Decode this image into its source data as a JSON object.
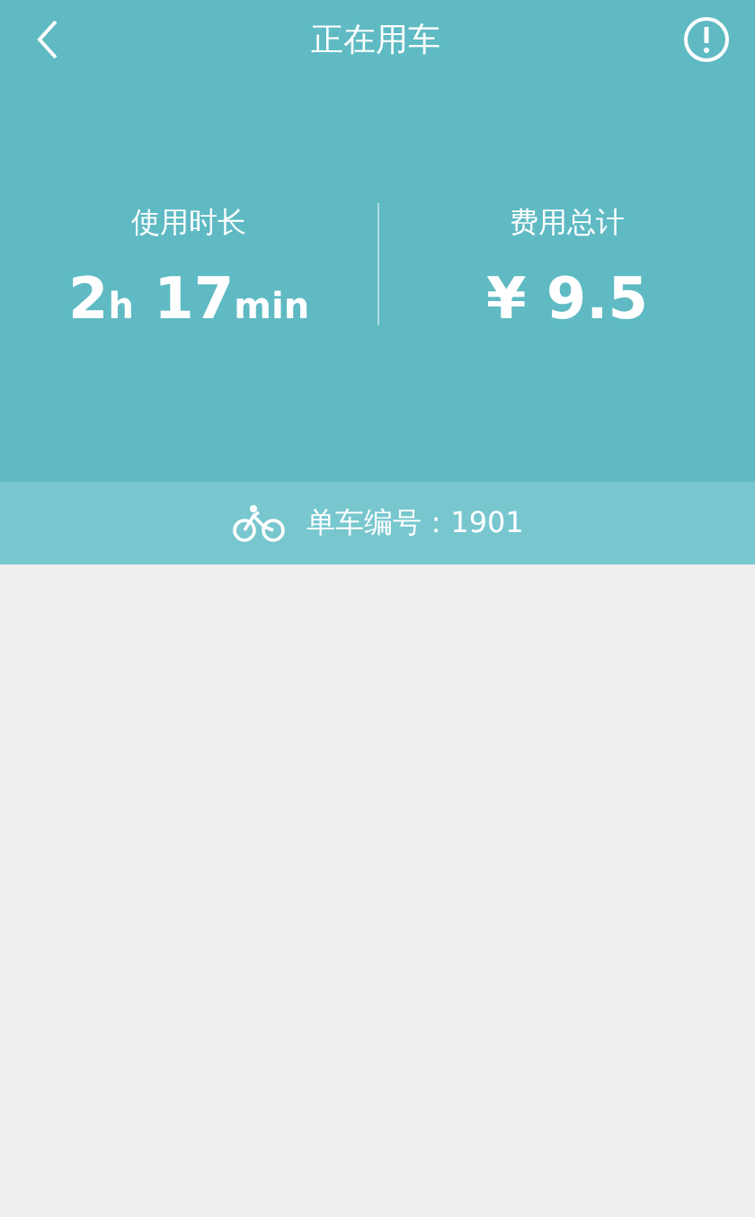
{
  "header": {
    "title": "正在用车"
  },
  "stats": [
    {
      "label": "使用时长",
      "parts": [
        {
          "kind": "number",
          "text": "2"
        },
        {
          "kind": "unit",
          "text": "h"
        },
        {
          "kind": "number",
          "text": " 17"
        },
        {
          "kind": "unit",
          "text": "min"
        }
      ]
    },
    {
      "label": "费用总计",
      "parts": [
        {
          "kind": "number",
          "text": "¥ 9.5"
        }
      ]
    }
  ],
  "bike_bar": {
    "text": "单车编号：1901"
  }
}
